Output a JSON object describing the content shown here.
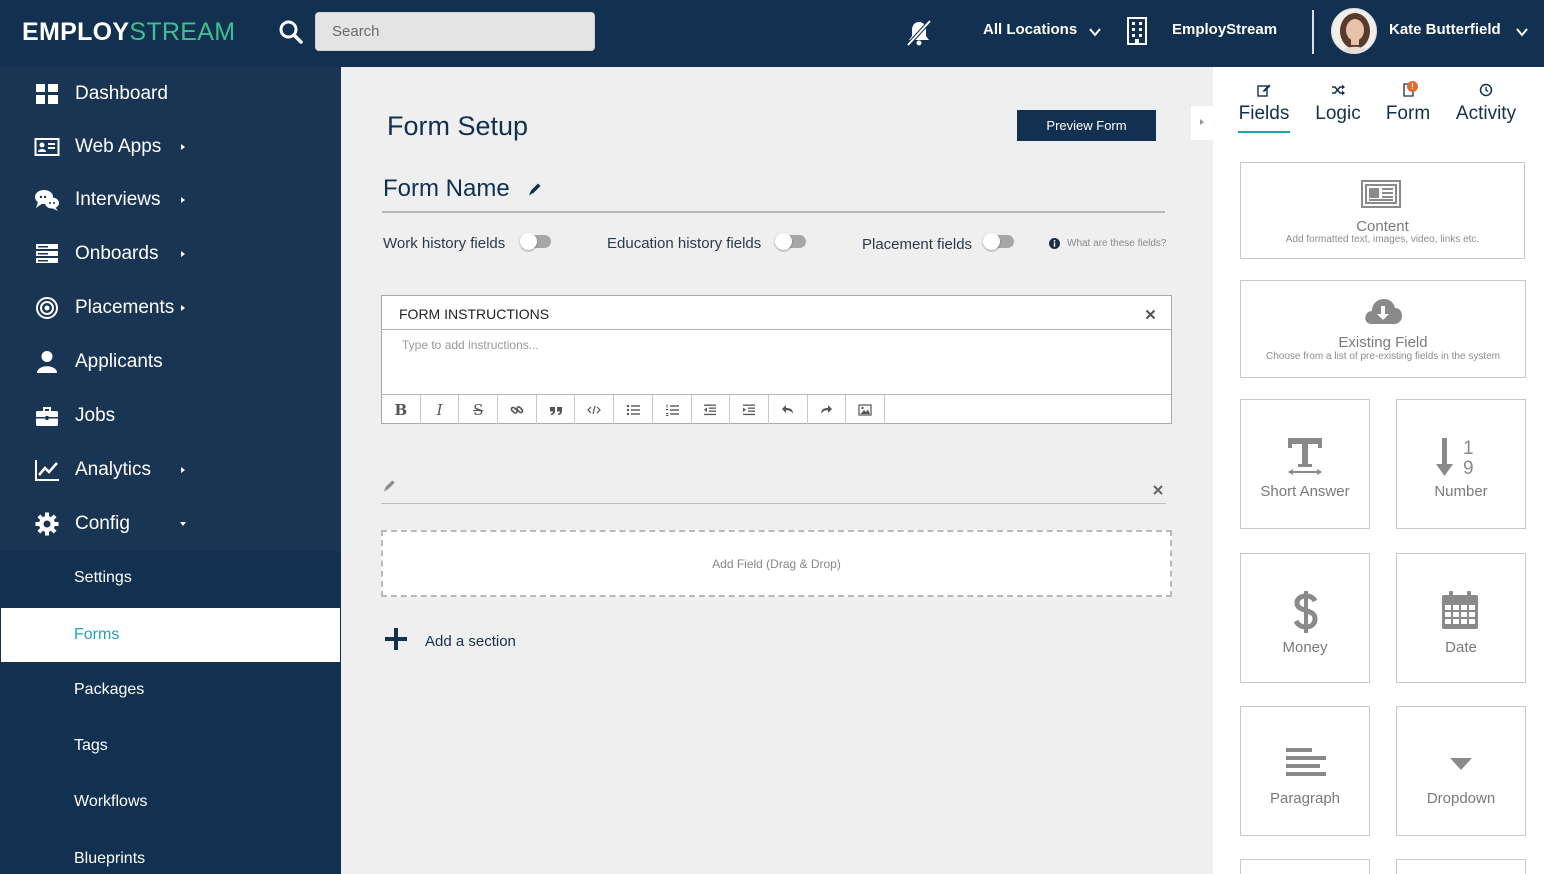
{
  "header": {
    "logo_part1": "EMPLOY",
    "logo_part2": "STREAM",
    "search_placeholder": "Search",
    "locations_label": "All Locations",
    "company_name": "EmployStream",
    "user_name": "Kate Butterfield"
  },
  "sidebar": {
    "items": [
      {
        "label": "Dashboard",
        "icon": "dashboard-icon"
      },
      {
        "label": "Web Apps",
        "icon": "id-card-icon"
      },
      {
        "label": "Interviews",
        "icon": "chat-bubbles-icon"
      },
      {
        "label": "Onboards",
        "icon": "server-icon"
      },
      {
        "label": "Placements",
        "icon": "target-icon"
      },
      {
        "label": "Applicants",
        "icon": "user-icon"
      },
      {
        "label": "Jobs",
        "icon": "briefcase-icon"
      },
      {
        "label": "Analytics",
        "icon": "line-chart-icon"
      },
      {
        "label": "Config",
        "icon": "gear-icon"
      }
    ],
    "subitems": [
      {
        "label": "Settings"
      },
      {
        "label": "Forms",
        "active": true
      },
      {
        "label": "Packages"
      },
      {
        "label": "Tags"
      },
      {
        "label": "Workflows"
      },
      {
        "label": "Blueprints"
      }
    ]
  },
  "main": {
    "title": "Form Setup",
    "preview_button": "Preview Form",
    "form_name": "Form Name",
    "toggles": [
      {
        "label": "Work history fields",
        "on": false
      },
      {
        "label": "Education history fields",
        "on": false
      },
      {
        "label": "Placement fields",
        "on": false
      }
    ],
    "info_link": "What are these fields?",
    "instructions_title": "FORM INSTRUCTIONS",
    "instructions_placeholder": "Type to add instructions...",
    "toolbar_buttons": [
      "bold",
      "italic",
      "strikethrough",
      "link",
      "quote",
      "code",
      "bulleted-list",
      "numbered-list",
      "outdent",
      "indent",
      "undo",
      "redo",
      "image"
    ],
    "dropzone_text": "Add Field (Drag & Drop)",
    "add_section": "Add a section"
  },
  "rightpanel": {
    "tabs": [
      {
        "label": "Fields",
        "icon": "edit-icon",
        "active": true
      },
      {
        "label": "Logic",
        "icon": "shuffle-icon"
      },
      {
        "label": "Form",
        "icon": "document-icon",
        "badge": "!"
      },
      {
        "label": "Activity",
        "icon": "clock-icon"
      }
    ],
    "wide_cards": [
      {
        "name": "Content",
        "desc": "Add formatted text, images, video, links etc.",
        "icon": "newspaper-icon"
      },
      {
        "name": "Existing Field",
        "desc": "Choose from a list of pre-existing fields in the system",
        "icon": "cloud-download-icon"
      }
    ],
    "field_types": [
      {
        "name": "Short Answer",
        "icon": "text-height-icon"
      },
      {
        "name": "Number",
        "icon": "sort-numeric-icon"
      },
      {
        "name": "Money",
        "icon": "dollar-icon"
      },
      {
        "name": "Date",
        "icon": "calendar-icon"
      },
      {
        "name": "Paragraph",
        "icon": "align-left-icon"
      },
      {
        "name": "Dropdown",
        "icon": "caret-down-icon"
      }
    ]
  },
  "colors": {
    "topbar": "#12304f",
    "sidebar": "#1a3554",
    "accent": "#21a3b5",
    "logo_green": "#3fbf8f",
    "badge": "#e5692c"
  }
}
